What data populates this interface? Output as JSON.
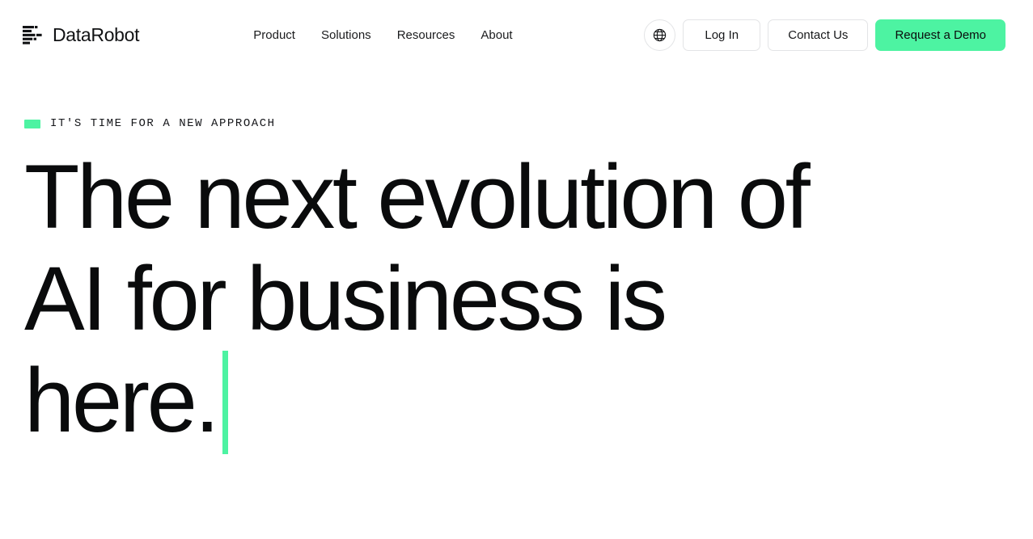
{
  "theme": {
    "accent": "#4df3a2",
    "text": "#0b0c0d",
    "background": "#ffffff",
    "border": "#e3e4e6"
  },
  "header": {
    "brand": {
      "name": "DataRobot",
      "mark_icon": "datarobot-bars-logo-icon"
    },
    "nav": [
      {
        "label": "Product"
      },
      {
        "label": "Solutions"
      },
      {
        "label": "Resources"
      },
      {
        "label": "About"
      }
    ],
    "actions": {
      "language_icon": "globe-icon",
      "login_label": "Log In",
      "contact_label": "Contact Us",
      "demo_label": "Request a Demo"
    }
  },
  "hero": {
    "eyebrow": "IT'S TIME FOR A NEW APPROACH",
    "title_line_1": "The next evolution of",
    "title_line_2": "AI for business is",
    "title_line_3": "here.",
    "caret": "typing-caret"
  }
}
